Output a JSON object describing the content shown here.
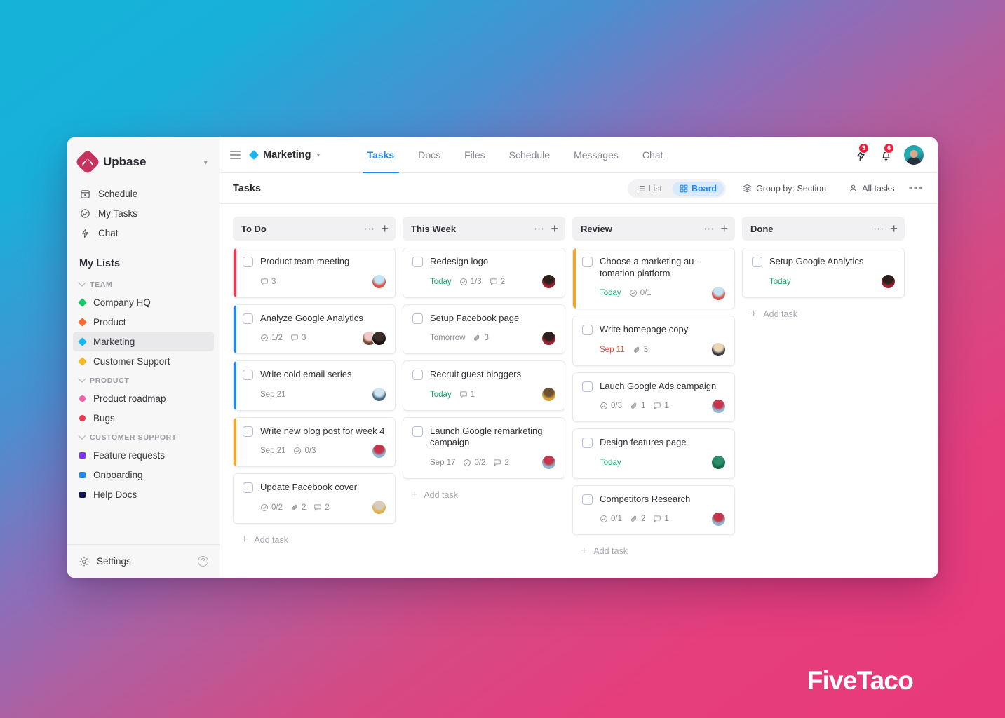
{
  "watermark": "FiveTaco",
  "brand": {
    "name": "Upbase",
    "caret": "chevron-down"
  },
  "sidebar": {
    "nav": [
      {
        "label": "Schedule",
        "icon": "calendar-icon"
      },
      {
        "label": "My Tasks",
        "icon": "check-circle-icon"
      },
      {
        "label": "Chat",
        "icon": "bolt-icon"
      }
    ],
    "my_lists_title": "My Lists",
    "groups": [
      {
        "label": "TEAM",
        "items": [
          {
            "label": "Company HQ",
            "color": "#17c964",
            "shape": "diamond",
            "active": false
          },
          {
            "label": "Product",
            "color": "#f96a33",
            "shape": "diamond",
            "active": false
          },
          {
            "label": "Marketing",
            "color": "#17b6ef",
            "shape": "diamond",
            "active": true
          },
          {
            "label": "Customer Support",
            "color": "#f5b723",
            "shape": "diamond",
            "active": false
          }
        ]
      },
      {
        "label": "PRODUCT",
        "items": [
          {
            "label": "Product roadmap",
            "color": "#f75fa8",
            "shape": "circle",
            "active": false
          },
          {
            "label": "Bugs",
            "color": "#f4354f",
            "shape": "circle",
            "active": false
          }
        ]
      },
      {
        "label": "CUSTOMER SUPPORT",
        "items": [
          {
            "label": "Feature requests",
            "color": "#8034f0",
            "shape": "square",
            "active": false
          },
          {
            "label": "Onboarding",
            "color": "#2186f0",
            "shape": "square",
            "active": false
          },
          {
            "label": "Help Docs",
            "color": "#111453",
            "shape": "square",
            "active": false
          }
        ]
      }
    ],
    "footer": {
      "settings_label": "Settings",
      "help_label": "?"
    }
  },
  "topbar": {
    "space_name": "Marketing",
    "space_color": "#17b6ef",
    "tabs": [
      {
        "label": "Tasks",
        "active": true
      },
      {
        "label": "Docs",
        "active": false
      },
      {
        "label": "Files",
        "active": false
      },
      {
        "label": "Schedule",
        "active": false
      },
      {
        "label": "Messages",
        "active": false
      },
      {
        "label": "Chat",
        "active": false
      }
    ],
    "bolt_badge": "3",
    "bell_badge": "6",
    "accent": "#2186f0",
    "badge_color": "#f01d3a"
  },
  "toolbar": {
    "title": "Tasks",
    "view_list": "List",
    "view_board": "Board",
    "group_by": "Group by: Section",
    "all_tasks": "All tasks",
    "more": "•••"
  },
  "board": {
    "add_task_label": "Add task",
    "columns": [
      {
        "title": "To Do",
        "cards": [
          {
            "title": "Product team meeting",
            "accent": "#f4354f",
            "date": "",
            "date_kind": "",
            "subtasks": "",
            "attachments": "",
            "comments": "3",
            "avatars": [
              "#c2e3f2|#d9534f"
            ]
          },
          {
            "title": "Analyze Google Analytics",
            "accent": "#f4354f",
            "date": "",
            "date_kind": "",
            "subtasks": "1/2",
            "attachments": "",
            "comments": "3",
            "avatars": [
              "#f0c8c8|#7a4a3a",
              "#3b2e2a|#1d1512"
            ]
          },
          {
            "title": "Write cold email series",
            "accent": "#2186f0",
            "date": "Sep 21",
            "date_kind": "plain",
            "subtasks": "",
            "attachments": "",
            "comments": "",
            "avatars": [
              "#cfe5f2|#4a6b80"
            ]
          },
          {
            "title": "Write new blog post for week 4",
            "accent": "#2186f0",
            "date": "Sep 21",
            "date_kind": "plain",
            "subtasks": "0/3",
            "attachments": "",
            "comments": "",
            "avatars": [
              "#c2354a|#8fb8cf"
            ]
          },
          {
            "title": "Update Facebook cover",
            "accent": "#f5a623",
            "date": "",
            "date_kind": "",
            "subtasks": "0/2",
            "attachments": "2",
            "comments": "2",
            "avatars": [
              "#d8cdbc|#e0b352"
            ]
          }
        ]
      },
      {
        "title": "This Week",
        "cards": [
          {
            "title": "Redesign logo",
            "accent": "#f4354f",
            "date": "Today",
            "date_kind": "today",
            "subtasks": "1/3",
            "attachments": "",
            "comments": "2",
            "avatars": [
              "#2b1f1c|#9b2233"
            ]
          },
          {
            "title": "Setup Facebook page",
            "accent": "",
            "date": "Tomorrow",
            "date_kind": "plain",
            "subtasks": "",
            "attachments": "3",
            "comments": "",
            "avatars": [
              "#2b1f1c|#9b2233"
            ]
          },
          {
            "title": "Recruit guest bloggers",
            "accent": "#2186f0",
            "date": "Today",
            "date_kind": "today",
            "subtasks": "",
            "attachments": "",
            "comments": "1",
            "avatars": [
              "#6b5234|#d8a13a"
            ]
          },
          {
            "title": "Launch Google remarketing campaign",
            "accent": "",
            "date": "Sep 17",
            "date_kind": "plain",
            "subtasks": "0/2",
            "attachments": "",
            "comments": "2",
            "avatars": [
              "#c2354a|#8fb8cf"
            ]
          }
        ]
      },
      {
        "title": "Review",
        "cards": [
          {
            "title": "Choose a marketing au­tomation platform",
            "accent": "#f4354f",
            "date": "Today",
            "date_kind": "today",
            "subtasks": "0/1",
            "attachments": "",
            "comments": "",
            "avatars": [
              "#c2e3f2|#d9534f"
            ]
          },
          {
            "title": "Write homepage copy",
            "accent": "#f5a623",
            "date": "Sep 11",
            "date_kind": "overdue",
            "subtasks": "",
            "attachments": "3",
            "comments": "",
            "avatars": [
              "#e8d7b8|#3a3a40"
            ]
          },
          {
            "title": "Lauch Google Ads campaign",
            "accent": "",
            "date": "",
            "date_kind": "",
            "subtasks": "0/3",
            "attachments": "1",
            "comments": "1",
            "avatars": [
              "#c2354a|#8fb8cf"
            ]
          },
          {
            "title": "Design features page",
            "accent": "#f5a623",
            "date": "Today",
            "date_kind": "today",
            "subtasks": "",
            "attachments": "",
            "comments": "",
            "avatars": [
              "#2c8f6a|#18694d"
            ]
          },
          {
            "title": "Competitors Research",
            "accent": "",
            "date": "",
            "date_kind": "",
            "subtasks": "0/1",
            "attachments": "2",
            "comments": "1",
            "avatars": [
              "#c2354a|#8fb8cf"
            ]
          }
        ]
      },
      {
        "title": "Done",
        "cards": [
          {
            "title": "Setup Google Analytics",
            "accent": "#2186f0",
            "date": "Today",
            "date_kind": "today",
            "subtasks": "",
            "attachments": "",
            "comments": "",
            "avatars": [
              "#2b1f1c|#9b2233"
            ]
          }
        ]
      }
    ]
  }
}
